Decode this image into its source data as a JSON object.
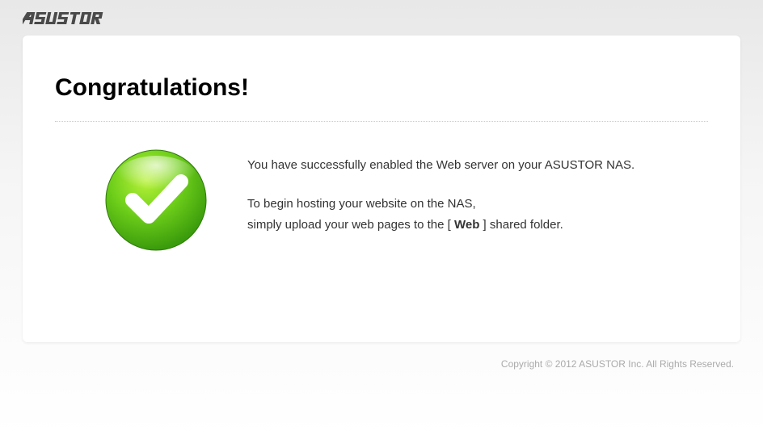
{
  "brand": "asustor",
  "title": "Congratulations!",
  "message1": "You have successfully enabled the Web server on your ASUSTOR NAS.",
  "message2": "To begin hosting your website on the NAS,",
  "message3_prefix": "simply upload your web pages to the [ ",
  "message3_bold": "Web",
  "message3_suffix": " ] shared folder.",
  "footer": "Copyright © 2012 ASUSTOR Inc. All Rights Reserved."
}
